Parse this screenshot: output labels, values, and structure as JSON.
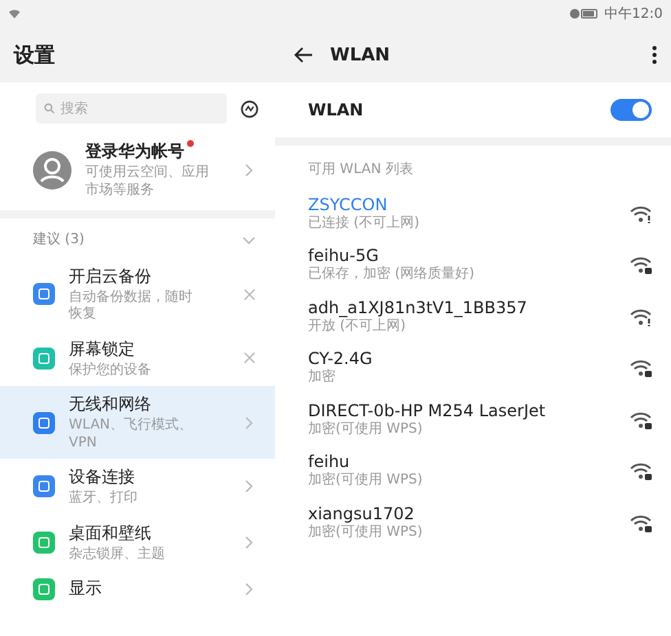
{
  "status_bar": {
    "time": "中午12:0"
  },
  "settings": {
    "title": "设置",
    "search": {
      "placeholder": "搜索"
    },
    "account": {
      "title": "登录华为帐号",
      "subtitle": "可使用云空间、应用市场等服务",
      "badge": true
    },
    "suggestions_header": {
      "label": "建议 (3)",
      "expanded": true
    },
    "items": [
      {
        "kind": "suggestion",
        "title": "开启云备份",
        "subtitle": "自动备份数据，随时恢复",
        "color": "#3a86f0",
        "selected": false
      },
      {
        "kind": "suggestion",
        "title": "屏幕锁定",
        "subtitle": "保护您的设备",
        "color": "#1fbfa8",
        "selected": false
      },
      {
        "kind": "setting",
        "title": "无线和网络",
        "subtitle": "WLAN、飞行模式、VPN",
        "color": "#2f7ff0",
        "selected": true
      },
      {
        "kind": "setting",
        "title": "设备连接",
        "subtitle": "蓝牙、打印",
        "color": "#3a86f0",
        "selected": false
      },
      {
        "kind": "setting",
        "title": "桌面和壁纸",
        "subtitle": "杂志锁屏、主题",
        "color": "#22c36b",
        "selected": false
      },
      {
        "kind": "setting",
        "title": "显示",
        "color": "#22c36b",
        "selected": false
      }
    ]
  },
  "wlan": {
    "title": "WLAN",
    "toggle": {
      "label": "WLAN",
      "on": true
    },
    "list_header": "可用 WLAN 列表",
    "networks": [
      {
        "name": "ZSYCCON",
        "status": "已连接 (不可上网)",
        "connected": true,
        "kind": "no_internet"
      },
      {
        "name": "feihu-5G",
        "status": "已保存，加密 (网络质量好)",
        "connected": false,
        "kind": "locked"
      },
      {
        "name": "adh_a1XJ81n3tV1_1BB357",
        "status": "开放 (不可上网)",
        "connected": false,
        "kind": "no_internet"
      },
      {
        "name": "CY-2.4G",
        "status": "加密",
        "connected": false,
        "kind": "locked"
      },
      {
        "name": "DIRECT-0b-HP M254 LaserJet",
        "status": "加密(可使用 WPS)",
        "connected": false,
        "kind": "locked"
      },
      {
        "name": "feihu",
        "status": "加密(可使用 WPS)",
        "connected": false,
        "kind": "locked"
      },
      {
        "name": "xiangsu1702",
        "status": "加密(可使用 WPS)",
        "connected": false,
        "kind": "locked"
      }
    ]
  }
}
